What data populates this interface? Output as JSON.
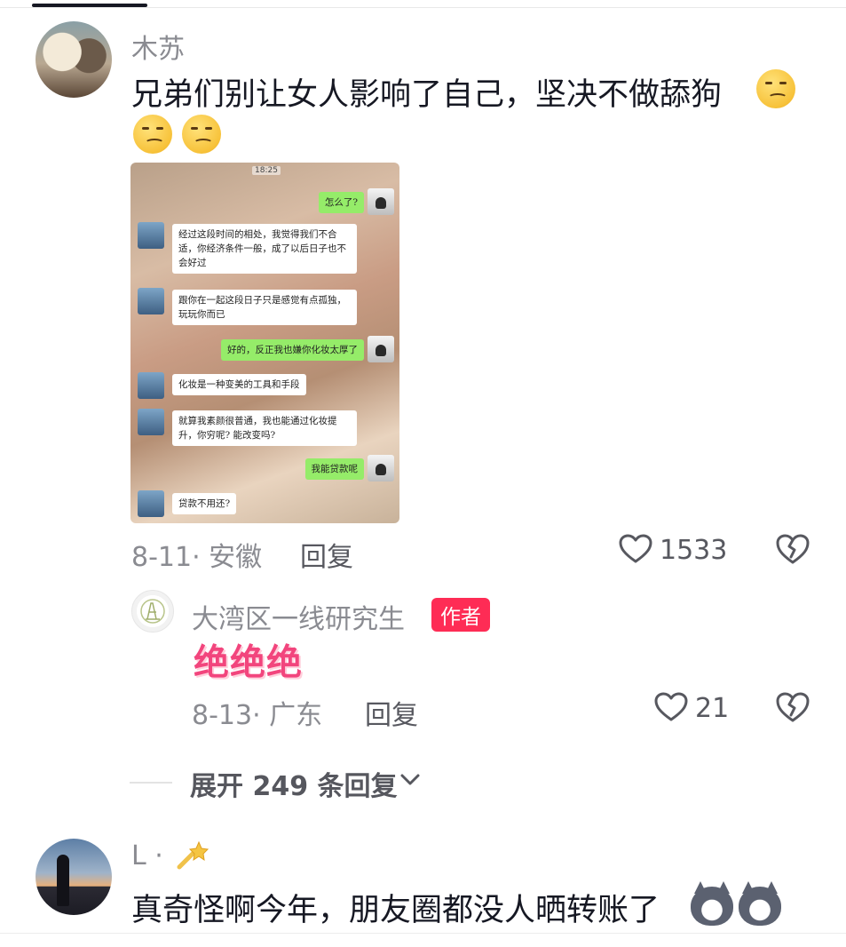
{
  "comments": [
    {
      "username": "木苏",
      "text": "兄弟们别让女人影响了自己，坚决不做舔狗",
      "date_location": "8-11· 安徽",
      "reply_label": "回复",
      "likes": "1533",
      "emoji": "smirk-emoji"
    },
    {
      "username": "L ·",
      "text": "真奇怪啊今年，朋友圈都没人晒转账了",
      "emoji": "husky-emoji"
    }
  ],
  "screenshot": {
    "time": "18:25",
    "messages": [
      {
        "side": "right",
        "text": "怎么了?"
      },
      {
        "side": "left",
        "text": "经过这段时间的相处，我觉得我们不合适，你经济条件一般，成了以后日子也不会好过"
      },
      {
        "side": "left",
        "text": "跟你在一起这段日子只是感觉有点孤独，玩玩你而已"
      },
      {
        "side": "right",
        "text": "好的，反正我也嫌你化妆太厚了"
      },
      {
        "side": "left",
        "text": "化妆是一种变美的工具和手段"
      },
      {
        "side": "left",
        "text": "就算我素颜很普通，我也能通过化妆提升，你穷呢? 能改变吗?"
      },
      {
        "side": "right",
        "text": "我能贷款呢"
      },
      {
        "side": "left",
        "text": "贷款不用还?"
      }
    ]
  },
  "reply": {
    "username": "大湾区一线研究生",
    "badge": "作者",
    "text": "绝绝绝",
    "date_location": "8-13· 广东",
    "reply_label": "回复",
    "likes": "21"
  },
  "expand_label": "展开 249 条回复",
  "colors": {
    "badge": "#fe2c55",
    "highlight_text": "#f2457d",
    "chat_green": "#95ec69"
  }
}
